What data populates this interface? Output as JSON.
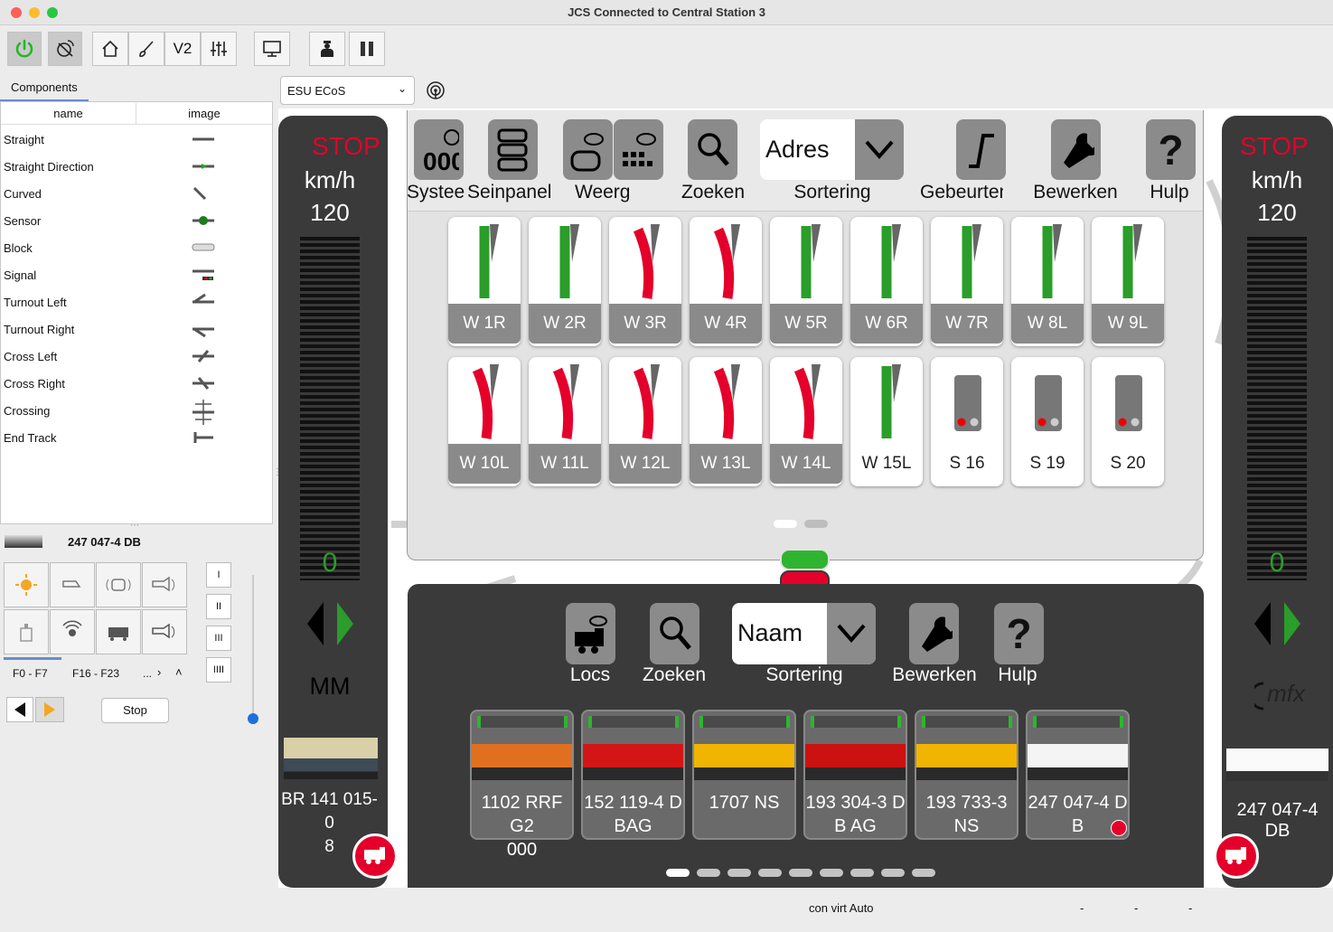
{
  "window": {
    "title": "JCS Connected to Central Station 3"
  },
  "toolbar": {
    "icons": [
      "power-icon",
      "satellite-icon",
      "home-icon",
      "brush-icon",
      "v2-icon",
      "sliders-icon",
      "monitor-icon",
      "driver-icon",
      "pause-icon"
    ],
    "v2_label": "V2"
  },
  "left_panel": {
    "tab": "Components",
    "columns": [
      "name",
      "image"
    ],
    "components": [
      "Straight",
      "Straight Direction",
      "Curved",
      "Sensor",
      "Block",
      "Signal",
      "Turnout Left",
      "Turnout Right",
      "Cross Left",
      "Cross Right",
      "Crossing",
      "End Track"
    ]
  },
  "driver": {
    "loco_name": "247 047-4 DB",
    "roman": [
      "I",
      "II",
      "III",
      "IIII"
    ],
    "func_tabs": [
      "F0 - F7",
      "F16 - F23",
      "..."
    ],
    "stop_label": "Stop",
    "speed_fraction": 0
  },
  "controller": {
    "selected": "ESU ECoS"
  },
  "left_throttle": {
    "stop": "STOP",
    "unit": "km/h",
    "max": "120",
    "speed": "0",
    "protocol": "MM",
    "loco_name": "BR 141 015-0\n8"
  },
  "right_throttle": {
    "stop": "STOP",
    "unit": "km/h",
    "max": "120",
    "speed": "0",
    "protocol": "mfx",
    "loco_name": "247 047-4 DB"
  },
  "keyboard": {
    "toolbar": [
      {
        "label": "Systeer",
        "icon": "digits-icon"
      },
      {
        "label": "Seinpanele",
        "icon": "panel-icon"
      },
      {
        "label": "Weerga",
        "icon": "view-icon"
      },
      {
        "label": "Zoeken",
        "icon": "search-icon"
      },
      {
        "label": "Sortering",
        "value": "Adres"
      },
      {
        "label": "Gebeurteni",
        "icon": "event-icon"
      },
      {
        "label": "Bewerken",
        "icon": "wrench-icon"
      },
      {
        "label": "Hulp",
        "icon": "help-icon"
      }
    ],
    "row1": [
      {
        "label": "W 1R",
        "state": "green"
      },
      {
        "label": "W 2R",
        "state": "green"
      },
      {
        "label": "W 3R",
        "state": "red"
      },
      {
        "label": "W 4R",
        "state": "red"
      },
      {
        "label": "W 5R",
        "state": "green"
      },
      {
        "label": "W 6R",
        "state": "green"
      },
      {
        "label": "W 7R",
        "state": "green"
      },
      {
        "label": "W 8L",
        "state": "green"
      },
      {
        "label": "W 9L",
        "state": "green"
      }
    ],
    "row2": [
      {
        "label": "W 10L",
        "state": "red"
      },
      {
        "label": "W 11L",
        "state": "red"
      },
      {
        "label": "W 12L",
        "state": "red"
      },
      {
        "label": "W 13L",
        "state": "red"
      },
      {
        "label": "W 14L",
        "state": "red"
      },
      {
        "label": "W 15L",
        "state": "green"
      },
      {
        "label": "S 16",
        "state": "signal"
      },
      {
        "label": "S 19",
        "state": "signal"
      },
      {
        "label": "S 20",
        "state": "signal"
      }
    ],
    "page": 1,
    "pages": 2
  },
  "loco_list": {
    "toolbar": [
      {
        "label": "Locs",
        "icon": "loco-view-icon"
      },
      {
        "label": "Zoeken",
        "icon": "search-icon"
      },
      {
        "label": "Sortering",
        "value": "Naam"
      },
      {
        "label": "Bewerken",
        "icon": "wrench-icon"
      },
      {
        "label": "Hulp",
        "icon": "help-icon"
      }
    ],
    "locos": [
      {
        "name": "1102 RRF G2\n000",
        "color": "#e07020"
      },
      {
        "name": "152 119-4 D\nBAG",
        "color": "#d41515"
      },
      {
        "name": "1707 NS",
        "color": "#f1b400"
      },
      {
        "name": "193 304-3 D\nB AG",
        "color": "#cc1111"
      },
      {
        "name": "193 733-3 NS",
        "color": "#f1b400"
      },
      {
        "name": "247 047-4 D\nB",
        "color": "#f4f4f4"
      }
    ],
    "page": 1,
    "pages": 9
  },
  "status": {
    "text": "con virt Auto",
    "fields": [
      "-",
      "-",
      "-"
    ]
  },
  "colors": {
    "red": "#e4002b",
    "green": "#2a9d2a",
    "pane": "#3a3a3a"
  }
}
